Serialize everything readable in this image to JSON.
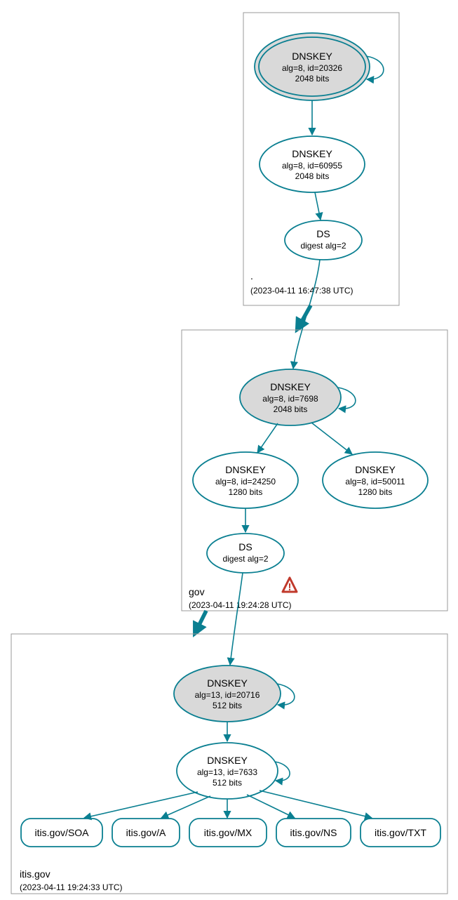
{
  "zones": {
    "root": {
      "label": ".",
      "timestamp": "(2023-04-11 16:47:38 UTC)",
      "ksk": {
        "title": "DNSKEY",
        "sub1": "alg=8, id=20326",
        "sub2": "2048 bits"
      },
      "zsk": {
        "title": "DNSKEY",
        "sub1": "alg=8, id=60955",
        "sub2": "2048 bits"
      },
      "ds": {
        "title": "DS",
        "sub1": "digest alg=2"
      }
    },
    "gov": {
      "label": "gov",
      "timestamp": "(2023-04-11 19:24:28 UTC)",
      "ksk": {
        "title": "DNSKEY",
        "sub1": "alg=8, id=7698",
        "sub2": "2048 bits"
      },
      "zsk1": {
        "title": "DNSKEY",
        "sub1": "alg=8, id=24250",
        "sub2": "1280 bits"
      },
      "zsk2": {
        "title": "DNSKEY",
        "sub1": "alg=8, id=50011",
        "sub2": "1280 bits"
      },
      "ds": {
        "title": "DS",
        "sub1": "digest alg=2"
      }
    },
    "itis": {
      "label": "itis.gov",
      "timestamp": "(2023-04-11 19:24:33 UTC)",
      "ksk": {
        "title": "DNSKEY",
        "sub1": "alg=13, id=20716",
        "sub2": "512 bits"
      },
      "zsk": {
        "title": "DNSKEY",
        "sub1": "alg=13, id=7633",
        "sub2": "512 bits"
      },
      "rr": {
        "soa": "itis.gov/SOA",
        "a": "itis.gov/A",
        "mx": "itis.gov/MX",
        "ns": "itis.gov/NS",
        "txt": "itis.gov/TXT"
      }
    }
  }
}
